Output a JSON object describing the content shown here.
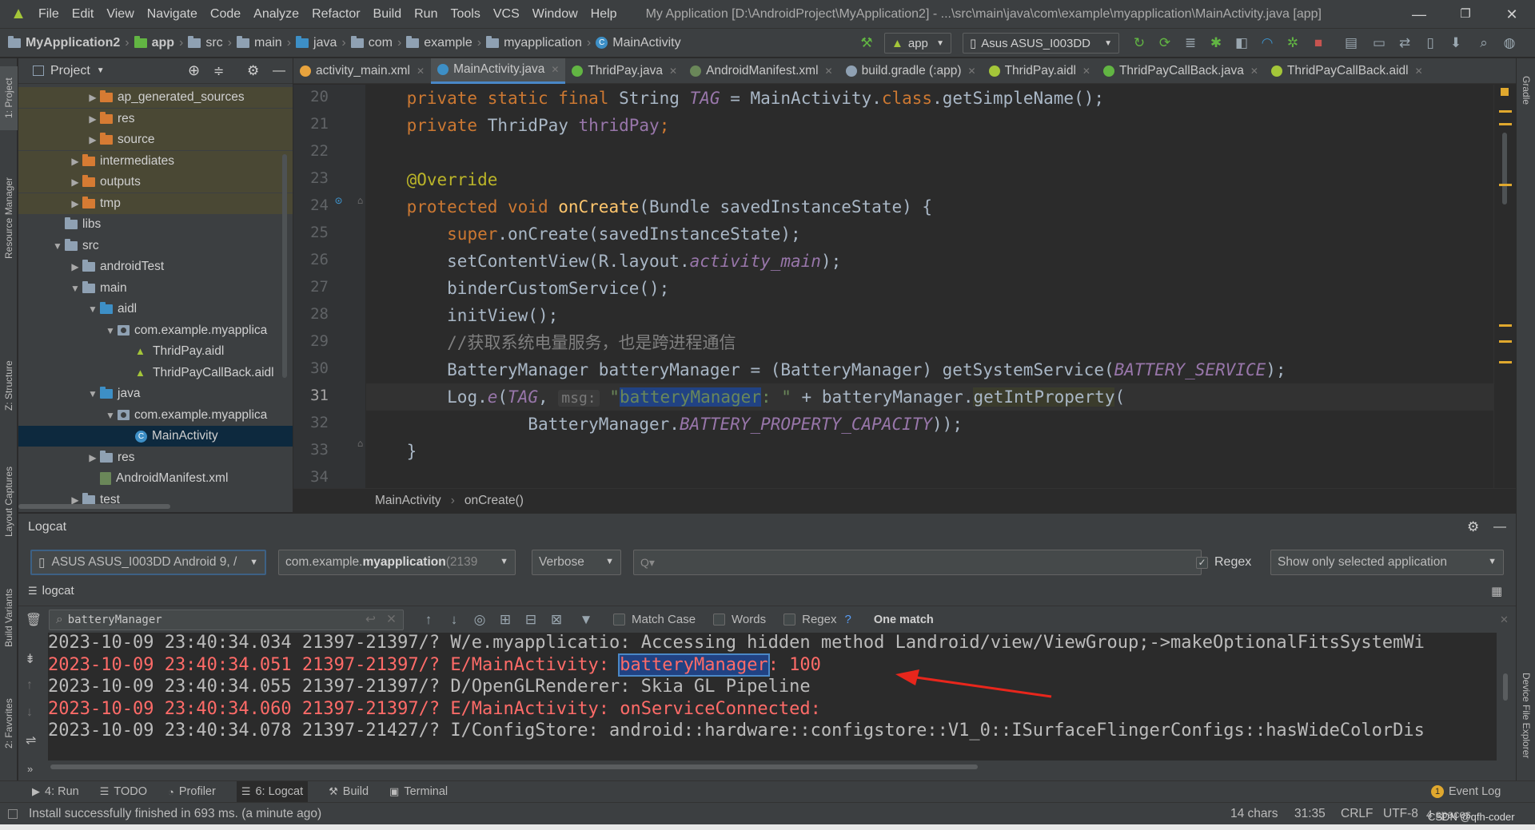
{
  "window": {
    "menu": [
      "File",
      "Edit",
      "View",
      "Navigate",
      "Code",
      "Analyze",
      "Refactor",
      "Build",
      "Run",
      "Tools",
      "VCS",
      "Window",
      "Help"
    ],
    "title": "My Application [D:\\AndroidProject\\MyApplication2] - ...\\src\\main\\java\\com\\example\\myapplication\\MainActivity.java [app]",
    "controls": [
      "—",
      "❐",
      "✕"
    ]
  },
  "navbar": {
    "crumbs": [
      "MyApplication2",
      "app",
      "src",
      "main",
      "java",
      "com",
      "example",
      "myapplication",
      "MainActivity"
    ],
    "run_config": "app",
    "device": "Asus ASUS_I003DD"
  },
  "left_stripe": [
    "1: Project",
    "Resource Manager",
    "Z: Structure",
    "Layout Captures",
    "Build Variants",
    "2: Favorites"
  ],
  "right_stripe": [
    "Gradle",
    "Device File Explorer"
  ],
  "project": {
    "header": "Project",
    "tree": [
      {
        "label": "ap_generated_sources",
        "depth": 4,
        "arrow": "▶",
        "icon": "folder-orange",
        "style": "olive"
      },
      {
        "label": "res",
        "depth": 4,
        "arrow": "▶",
        "icon": "folder-orange",
        "style": "olive"
      },
      {
        "label": "source",
        "depth": 4,
        "arrow": "▶",
        "icon": "folder-orange",
        "style": "olive"
      },
      {
        "label": "intermediates",
        "depth": 3,
        "arrow": "▶",
        "icon": "folder-orange",
        "style": "olive"
      },
      {
        "label": "outputs",
        "depth": 3,
        "arrow": "▶",
        "icon": "folder-orange",
        "style": "olive"
      },
      {
        "label": "tmp",
        "depth": 3,
        "arrow": "▶",
        "icon": "folder-orange",
        "style": "olive"
      },
      {
        "label": "libs",
        "depth": 2,
        "arrow": "",
        "icon": "folder",
        "style": ""
      },
      {
        "label": "src",
        "depth": 2,
        "arrow": "▼",
        "icon": "folder",
        "style": ""
      },
      {
        "label": "androidTest",
        "depth": 3,
        "arrow": "▶",
        "icon": "folder",
        "style": ""
      },
      {
        "label": "main",
        "depth": 3,
        "arrow": "▼",
        "icon": "folder",
        "style": ""
      },
      {
        "label": "aidl",
        "depth": 4,
        "arrow": "▼",
        "icon": "folder-blue",
        "style": ""
      },
      {
        "label": "com.example.myapplica",
        "depth": 5,
        "arrow": "▼",
        "icon": "package",
        "style": ""
      },
      {
        "label": "ThridPay.aidl",
        "depth": 6,
        "arrow": "",
        "icon": "aidl",
        "style": ""
      },
      {
        "label": "ThridPayCallBack.aidl",
        "depth": 6,
        "arrow": "",
        "icon": "aidl",
        "style": ""
      },
      {
        "label": "java",
        "depth": 4,
        "arrow": "▼",
        "icon": "folder-blue",
        "style": ""
      },
      {
        "label": "com.example.myapplica",
        "depth": 5,
        "arrow": "▼",
        "icon": "package",
        "style": ""
      },
      {
        "label": "MainActivity",
        "depth": 6,
        "arrow": "",
        "icon": "class",
        "style": "selected"
      },
      {
        "label": "res",
        "depth": 4,
        "arrow": "▶",
        "icon": "folder",
        "style": ""
      },
      {
        "label": "AndroidManifest.xml",
        "depth": 4,
        "arrow": "",
        "icon": "xml",
        "style": ""
      },
      {
        "label": "test",
        "depth": 3,
        "arrow": "▶",
        "icon": "folder",
        "style": ""
      }
    ]
  },
  "tabs": [
    {
      "label": "activity_main.xml",
      "color": "#e8a33d",
      "active": false
    },
    {
      "label": "MainActivity.java",
      "color": "#3d8fc6",
      "active": true
    },
    {
      "label": "ThridPay.java",
      "color": "#62b543",
      "active": false
    },
    {
      "label": "AndroidManifest.xml",
      "color": "#6a8759",
      "active": false
    },
    {
      "label": "build.gradle (:app)",
      "color": "#8fa1b3",
      "active": false
    },
    {
      "label": "ThridPay.aidl",
      "color": "#a4c639",
      "active": false
    },
    {
      "label": "ThridPayCallBack.java",
      "color": "#62b543",
      "active": false
    },
    {
      "label": "ThridPayCallBack.aidl",
      "color": "#a4c639",
      "active": false
    }
  ],
  "editor": {
    "line_numbers": [
      "20",
      "21",
      "22",
      "23",
      "24",
      "25",
      "26",
      "27",
      "28",
      "29",
      "30",
      "31",
      "32",
      "33",
      "34"
    ],
    "code": {
      "l20_kw": "private static final ",
      "l20_type": "String ",
      "l20_fld": "TAG",
      "l20_rest": " = MainActivity.",
      "l20_kw2": "class",
      "l20_end": ".getSimpleName();",
      "l21_kw": "private ",
      "l21_type": "ThridPay ",
      "l21_fld": "thridPay",
      "l21_end": ";",
      "l23_ann": "@Override",
      "l24_kw": "protected void ",
      "l24_fn": "onCreate",
      "l24_end": "(Bundle savedInstanceState) {",
      "l25_kw": "super",
      "l25_end": ".onCreate(savedInstanceState);",
      "l26_a": "setContentView(R.layout.",
      "l26_fld": "activity_main",
      "l26_end": ");",
      "l27": "binderCustomService();",
      "l28": "initView();",
      "l29_cmt": "//获取系统电量服务，也是跨进程通信",
      "l30_a": "BatteryManager batteryManager = (BatteryManager) getSystemService(",
      "l30_fld": "BATTERY_SERVICE",
      "l30_end": ");",
      "l31_a": "Log.",
      "l31_e": "e",
      "l31_b": "(",
      "l31_fld": "TAG",
      "l31_c": ", ",
      "l31_hint": "msg:",
      "l31_q": " \"",
      "l31_hl": "batteryManager",
      "l31_str": ": \"",
      "l31_d": " + batteryManager.",
      "l31_fn": "getIntProperty",
      "l31_end": "(",
      "l32_a": "BatteryManager.",
      "l32_fld": "BATTERY_PROPERTY_CAPACITY",
      "l32_end": "));",
      "l33": "}"
    },
    "breadcrumb": [
      "MainActivity",
      "onCreate()"
    ]
  },
  "logcat": {
    "title": "Logcat",
    "device": "ASUS ASUS_I003DD Android 9, /",
    "process_prefix": "com.example.",
    "process_bold": "myapplication",
    "process_suffix": " (2139",
    "level": "Verbose",
    "search_placeholder": "Q▾",
    "regex_label": "Regex",
    "filter": "Show only selected application",
    "tab_label": "logcat",
    "find_value": "batteryManager",
    "match_case": "Match Case",
    "words": "Words",
    "regex2": "Regex",
    "help": "?",
    "match_count": "One match",
    "lines": [
      {
        "text": "2023-10-09 23:40:34.034 21397-21397/? W/e.myapplicatio: Accessing hidden method Landroid/view/ViewGroup;->makeOptionalFitsSystemWi",
        "level": "W"
      },
      {
        "pre": "2023-10-09 23:40:34.051 21397-21397/? E/MainActivity: ",
        "match": "batteryManager",
        "post": ": 100",
        "level": "E"
      },
      {
        "text": "2023-10-09 23:40:34.055 21397-21397/? D/OpenGLRenderer: Skia GL Pipeline",
        "level": "D"
      },
      {
        "text": "2023-10-09 23:40:34.060 21397-21397/? E/MainActivity: onServiceConnected:",
        "level": "E"
      },
      {
        "text": "2023-10-09 23:40:34.078 21397-21427/? I/ConfigStore: android::hardware::configstore::V1_0::ISurfaceFlingerConfigs::hasWideColorDis",
        "level": "I"
      }
    ]
  },
  "bottom_tools": [
    {
      "label": "4: Run",
      "icon": "▶"
    },
    {
      "label": "TODO",
      "icon": "☰"
    },
    {
      "label": "Profiler",
      "icon": "◔"
    },
    {
      "label": "6: Logcat",
      "icon": "☰"
    },
    {
      "label": "Build",
      "icon": "⚒"
    },
    {
      "label": "Terminal",
      "icon": "▣"
    }
  ],
  "event_log": "Event Log",
  "status": {
    "message": "Install successfully finished in 693 ms. (a minute ago)",
    "chars": "14 chars",
    "position": "31:35",
    "line_sep": "CRLF",
    "encoding": "UTF-8",
    "indent": "4 spaces",
    "watermark": "CSDN @qfh-coder"
  },
  "colors": {
    "accent": "#4a88c7",
    "error": "#ff6b68",
    "selection": "#0d293e",
    "arrow": "#e8261c"
  }
}
